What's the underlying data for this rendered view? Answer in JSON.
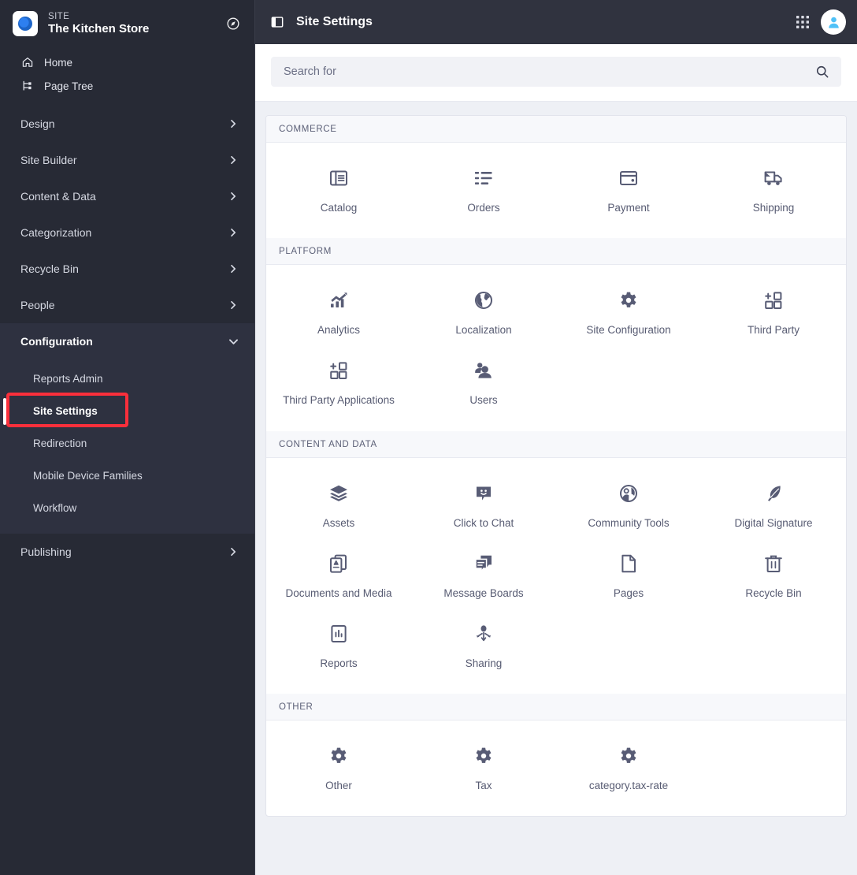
{
  "sidebar": {
    "brand": {
      "eyebrow": "SITE",
      "title": "The Kitchen Store",
      "logo_icon": "liferay-circle-logo",
      "action_icon": "compass-icon"
    },
    "quicklinks": [
      {
        "label": "Home",
        "icon": "home-icon"
      },
      {
        "label": "Page Tree",
        "icon": "page-tree-icon"
      }
    ],
    "groups": [
      {
        "label": "Design",
        "icon": "chevron-right-icon",
        "expanded": false
      },
      {
        "label": "Site Builder",
        "icon": "chevron-right-icon",
        "expanded": false
      },
      {
        "label": "Content & Data",
        "icon": "chevron-right-icon",
        "expanded": false
      },
      {
        "label": "Categorization",
        "icon": "chevron-right-icon",
        "expanded": false
      },
      {
        "label": "Recycle Bin",
        "icon": "chevron-right-icon",
        "expanded": false
      },
      {
        "label": "People",
        "icon": "chevron-right-icon",
        "expanded": false
      }
    ],
    "configuration": {
      "label": "Configuration",
      "icon": "chevron-down-icon",
      "items": [
        {
          "label": "Reports Admin",
          "active": false
        },
        {
          "label": "Site Settings",
          "active": true
        },
        {
          "label": "Redirection",
          "active": false
        },
        {
          "label": "Mobile Device Families",
          "active": false
        },
        {
          "label": "Workflow",
          "active": false
        }
      ]
    },
    "publishing": {
      "label": "Publishing",
      "icon": "chevron-right-icon"
    }
  },
  "topbar": {
    "panel_toggle_icon": "side-panel-icon",
    "title": "Site Settings",
    "grid_icon": "apps-grid-icon",
    "avatar_icon": "user-avatar-icon"
  },
  "search": {
    "placeholder": "Search for",
    "value": "",
    "icon": "search-icon"
  },
  "colors": {
    "sidebar_bg": "#272a35",
    "sidebar_open_bg": "#2e3140",
    "topbar_bg": "#30333f",
    "page_bg": "#eef0f5",
    "annotation": "#fa2f3b",
    "icon": "#585c75",
    "accent_blue": "#4fc1f7"
  },
  "sections": [
    {
      "title": "COMMERCE",
      "tiles": [
        {
          "label": "Catalog",
          "icon": "catalog-icon"
        },
        {
          "label": "Orders",
          "icon": "orders-list-icon"
        },
        {
          "label": "Payment",
          "icon": "payment-card-icon"
        },
        {
          "label": "Shipping",
          "icon": "shipping-truck-icon"
        }
      ]
    },
    {
      "title": "PLATFORM",
      "tiles": [
        {
          "label": "Analytics",
          "icon": "analytics-chart-icon"
        },
        {
          "label": "Localization",
          "icon": "globe-icon"
        },
        {
          "label": "Site Configuration",
          "icon": "gear-icon"
        },
        {
          "label": "Third Party",
          "icon": "third-party-plus-icon"
        },
        {
          "label": "Third Party Applications",
          "icon": "third-party-plus-icon"
        },
        {
          "label": "Users",
          "icon": "users-icon"
        }
      ]
    },
    {
      "title": "CONTENT AND DATA",
      "tiles": [
        {
          "label": "Assets",
          "icon": "layers-icon"
        },
        {
          "label": "Click to Chat",
          "icon": "chat-smiley-icon"
        },
        {
          "label": "Community Tools",
          "icon": "community-tools-icon"
        },
        {
          "label": "Digital Signature",
          "icon": "feather-pen-icon"
        },
        {
          "label": "Documents and Media",
          "icon": "documents-media-icon"
        },
        {
          "label": "Message Boards",
          "icon": "message-boards-icon"
        },
        {
          "label": "Pages",
          "icon": "page-icon"
        },
        {
          "label": "Recycle Bin",
          "icon": "trash-icon"
        },
        {
          "label": "Reports",
          "icon": "reports-bar-icon"
        },
        {
          "label": "Sharing",
          "icon": "sharing-node-icon"
        }
      ]
    },
    {
      "title": "OTHER",
      "tiles": [
        {
          "label": "Other",
          "icon": "gear-icon"
        },
        {
          "label": "Tax",
          "icon": "gear-icon"
        },
        {
          "label": "category.tax-rate",
          "icon": "gear-icon"
        }
      ]
    }
  ]
}
